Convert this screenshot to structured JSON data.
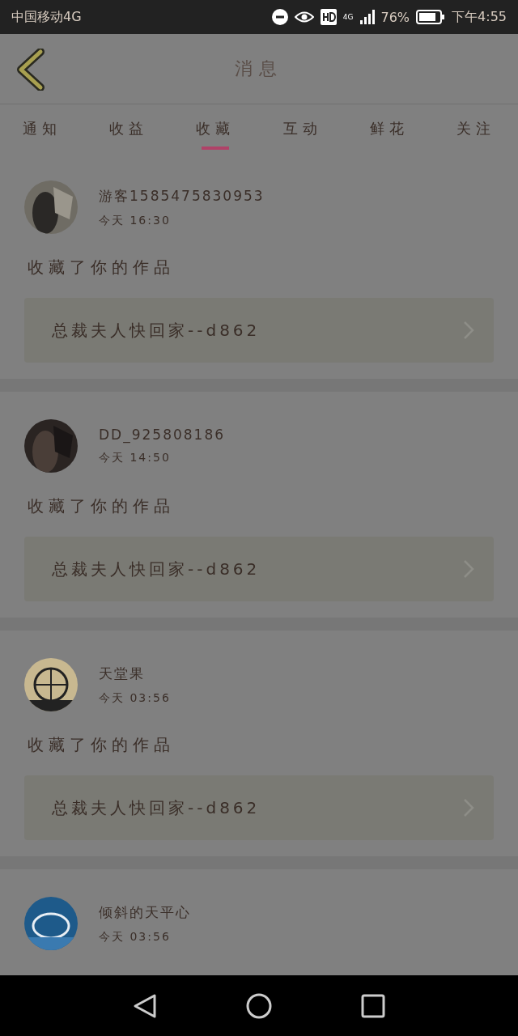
{
  "status_bar": {
    "carrier": "中国移动4G",
    "network": "4G",
    "battery": "76%",
    "time": "下午4:55"
  },
  "header": {
    "title": "消息"
  },
  "tabs": [
    {
      "label": "通知",
      "selected": false
    },
    {
      "label": "收益",
      "selected": false
    },
    {
      "label": "收藏",
      "selected": true
    },
    {
      "label": "互动",
      "selected": false
    },
    {
      "label": "鲜花",
      "selected": false
    },
    {
      "label": "关注",
      "selected": false
    }
  ],
  "messages": [
    {
      "user": "游客1585475830953",
      "time": "今天 16:30",
      "action": "收藏了你的作品",
      "work": "总裁夫人快回家--d862"
    },
    {
      "user": "DD_925808186",
      "time": "今天 14:50",
      "action": "收藏了你的作品",
      "work": "总裁夫人快回家--d862"
    },
    {
      "user": "天堂果",
      "time": "今天 03:56",
      "action": "收藏了你的作品",
      "work": "总裁夫人快回家--d862"
    },
    {
      "user": "倾斜的天平心",
      "time": "今天 03:56"
    }
  ]
}
